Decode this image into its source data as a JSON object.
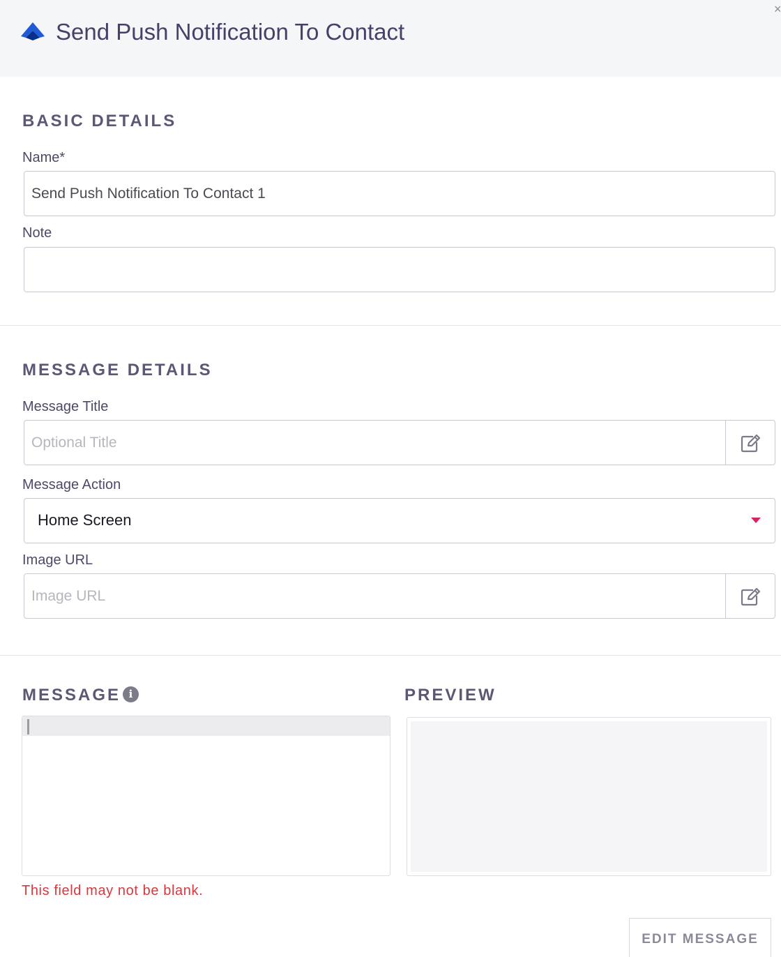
{
  "header": {
    "title": "Send Push Notification To Contact",
    "logo_icon": "paperboat-logo-icon",
    "close_icon": "close-icon",
    "close_glyph": "×"
  },
  "basic_details": {
    "heading": "BASIC DETAILS",
    "name_label": "Name*",
    "name_value": "Send Push Notification To Contact 1",
    "note_label": "Note",
    "note_value": ""
  },
  "message_details": {
    "heading": "MESSAGE DETAILS",
    "title_label": "Message Title",
    "title_placeholder": "Optional Title",
    "action_label": "Message Action",
    "action_value": "Home Screen",
    "image_label": "Image URL",
    "image_placeholder": "Image URL",
    "edit_icon": "edit-pencil-icon"
  },
  "message": {
    "heading": "MESSAGE",
    "info_icon": "info-icon",
    "info_glyph": "i",
    "error": "This field may not be blank."
  },
  "preview": {
    "heading": "PREVIEW"
  },
  "actions": {
    "edit_message": "EDIT MESSAGE"
  },
  "colors": {
    "accent": "#1f5bd8",
    "caret": "#d6245f",
    "error": "#d6383d",
    "heading": "#5a5874"
  }
}
